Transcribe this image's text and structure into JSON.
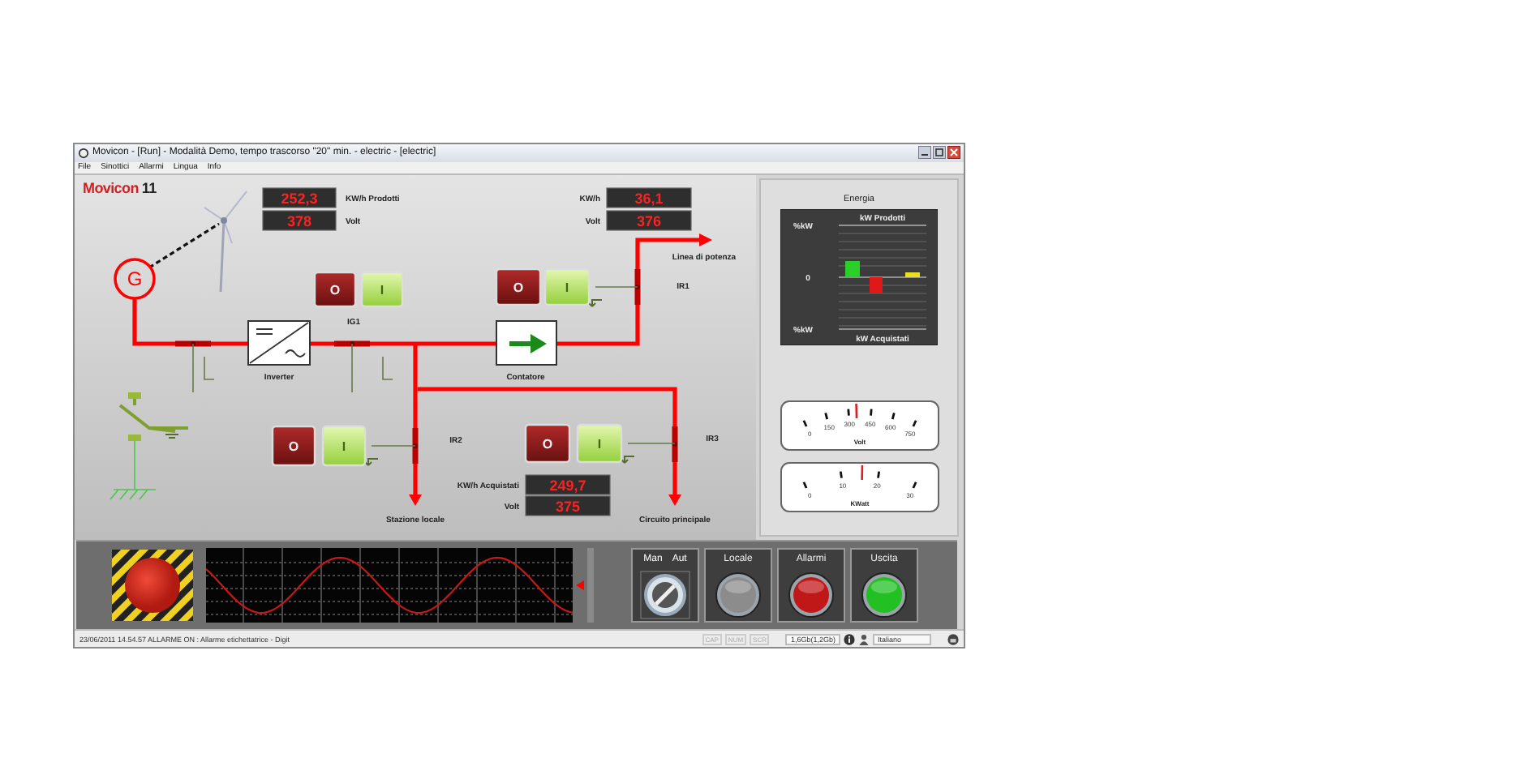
{
  "window": {
    "title": "Movicon - [Run] - Modalità Demo, tempo trascorso \"20\" min. - electric - [electric]"
  },
  "menu": [
    "File",
    "Sinottici",
    "Allarmi",
    "Lingua",
    "Info"
  ],
  "logo": {
    "name": "Movicon",
    "version": "11"
  },
  "diagram": {
    "generator": "G",
    "inverter": "Inverter",
    "meter": "Contatore",
    "outputs": [
      "Linea di potenza",
      "Stazione locale",
      "Circuito principale"
    ],
    "readouts": [
      {
        "label": "KW/h Prodotti",
        "value": "252,3"
      },
      {
        "label": "Volt",
        "value": "378"
      },
      {
        "label": "KW/h",
        "value": "36,1"
      },
      {
        "label": "Volt",
        "value": "376"
      },
      {
        "label": "KW/h Acquistati",
        "value": "249,7"
      },
      {
        "label": "Volt",
        "value": "375"
      }
    ],
    "breakers": [
      {
        "label": "IG1",
        "off": "O",
        "on": "I"
      },
      {
        "label": "IR1",
        "off": "O",
        "on": "I"
      },
      {
        "label": "IR2",
        "off": "O",
        "on": "I"
      },
      {
        "label": "IR3",
        "off": "O",
        "on": "I"
      }
    ]
  },
  "energy": {
    "title": "Energia",
    "top": "kW Prodotti",
    "bottom": "kW Acquistati",
    "axis_top": "%kW",
    "axis_zero": "0",
    "axis_bottom": "%kW"
  },
  "gauges": [
    {
      "unit": "Volt",
      "ticks": [
        "0",
        "150",
        "300",
        "450",
        "600",
        "750"
      ],
      "level": 0.47
    },
    {
      "unit": "KWatt",
      "ticks": [
        "0",
        "10",
        "20",
        "30"
      ],
      "level": 0.52
    }
  ],
  "controls": [
    {
      "kind": "selector",
      "labels": [
        "Man",
        "Aut"
      ],
      "on": true
    },
    {
      "kind": "lamp",
      "label": "Locale",
      "color": "#8c8c8c"
    },
    {
      "kind": "lamp",
      "label": "Allarmi",
      "color": "#c01818"
    },
    {
      "kind": "lamp",
      "label": "Uscita",
      "color": "#22c022"
    }
  ],
  "status_bar": {
    "message": "23/06/2011 14.54.57 ALLARME ON : Allarme etichettatrice - Digit",
    "indicators": [
      {
        "label": "CAP",
        "active": false
      },
      {
        "label": "NUM",
        "active": false
      },
      {
        "label": "SCR",
        "active": false
      }
    ],
    "memory": "1,6Gb(1,2Gb)",
    "language": "Italiano"
  }
}
